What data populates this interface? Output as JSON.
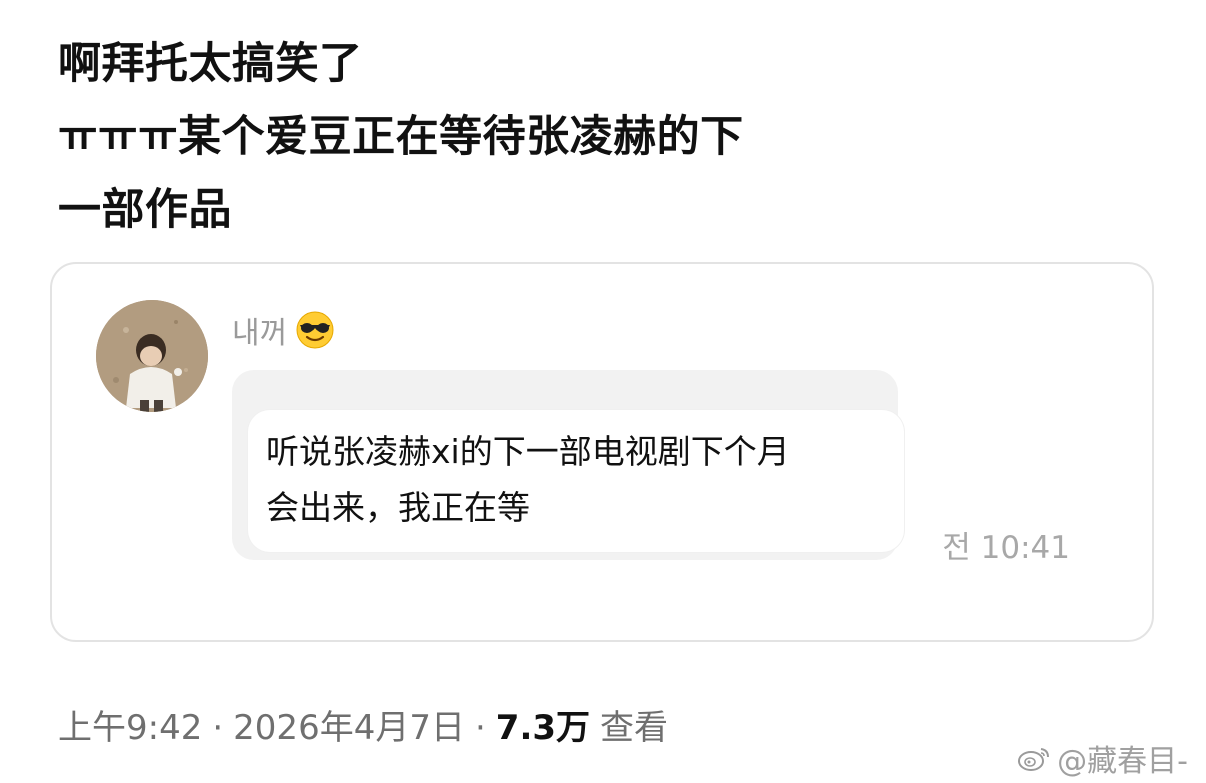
{
  "post": {
    "lines": [
      "啊拜托太搞笑了",
      "ㅠㅠㅠ某个爱豆正在等待张凌赫的下",
      "一部作品"
    ]
  },
  "quoted_message": {
    "sender_name": "내꺼",
    "emoji_icon": "smiling-face-with-sunglasses",
    "text_lines": [
      "听说张凌赫xi的下一部电视剧下个月",
      "会出来，我正在等"
    ],
    "time": "전 10:41"
  },
  "meta": {
    "time": "上午9:42",
    "date": "2026年4月7日",
    "separator": "·",
    "views": "7.3万",
    "views_label": "查看"
  },
  "watermark": {
    "text": "@藏春目-"
  }
}
